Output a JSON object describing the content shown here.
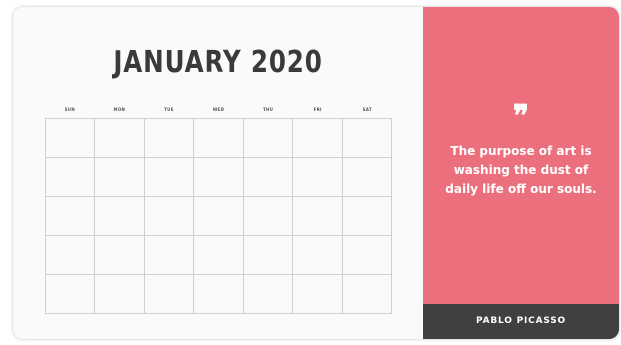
{
  "calendar": {
    "title": "JANUARY 2020",
    "weekdays": [
      "SUN",
      "MON",
      "TUE",
      "WED",
      "THU",
      "FRI",
      "SAT"
    ],
    "grid_color": "#d0d0d0"
  },
  "quote": {
    "mark": "❞",
    "text": "The purpose of art is washing the dust of daily life off our souls.",
    "author": "PABLO PICASSO",
    "panel_color": "#ec6f7d",
    "author_bar_color": "#404040"
  }
}
